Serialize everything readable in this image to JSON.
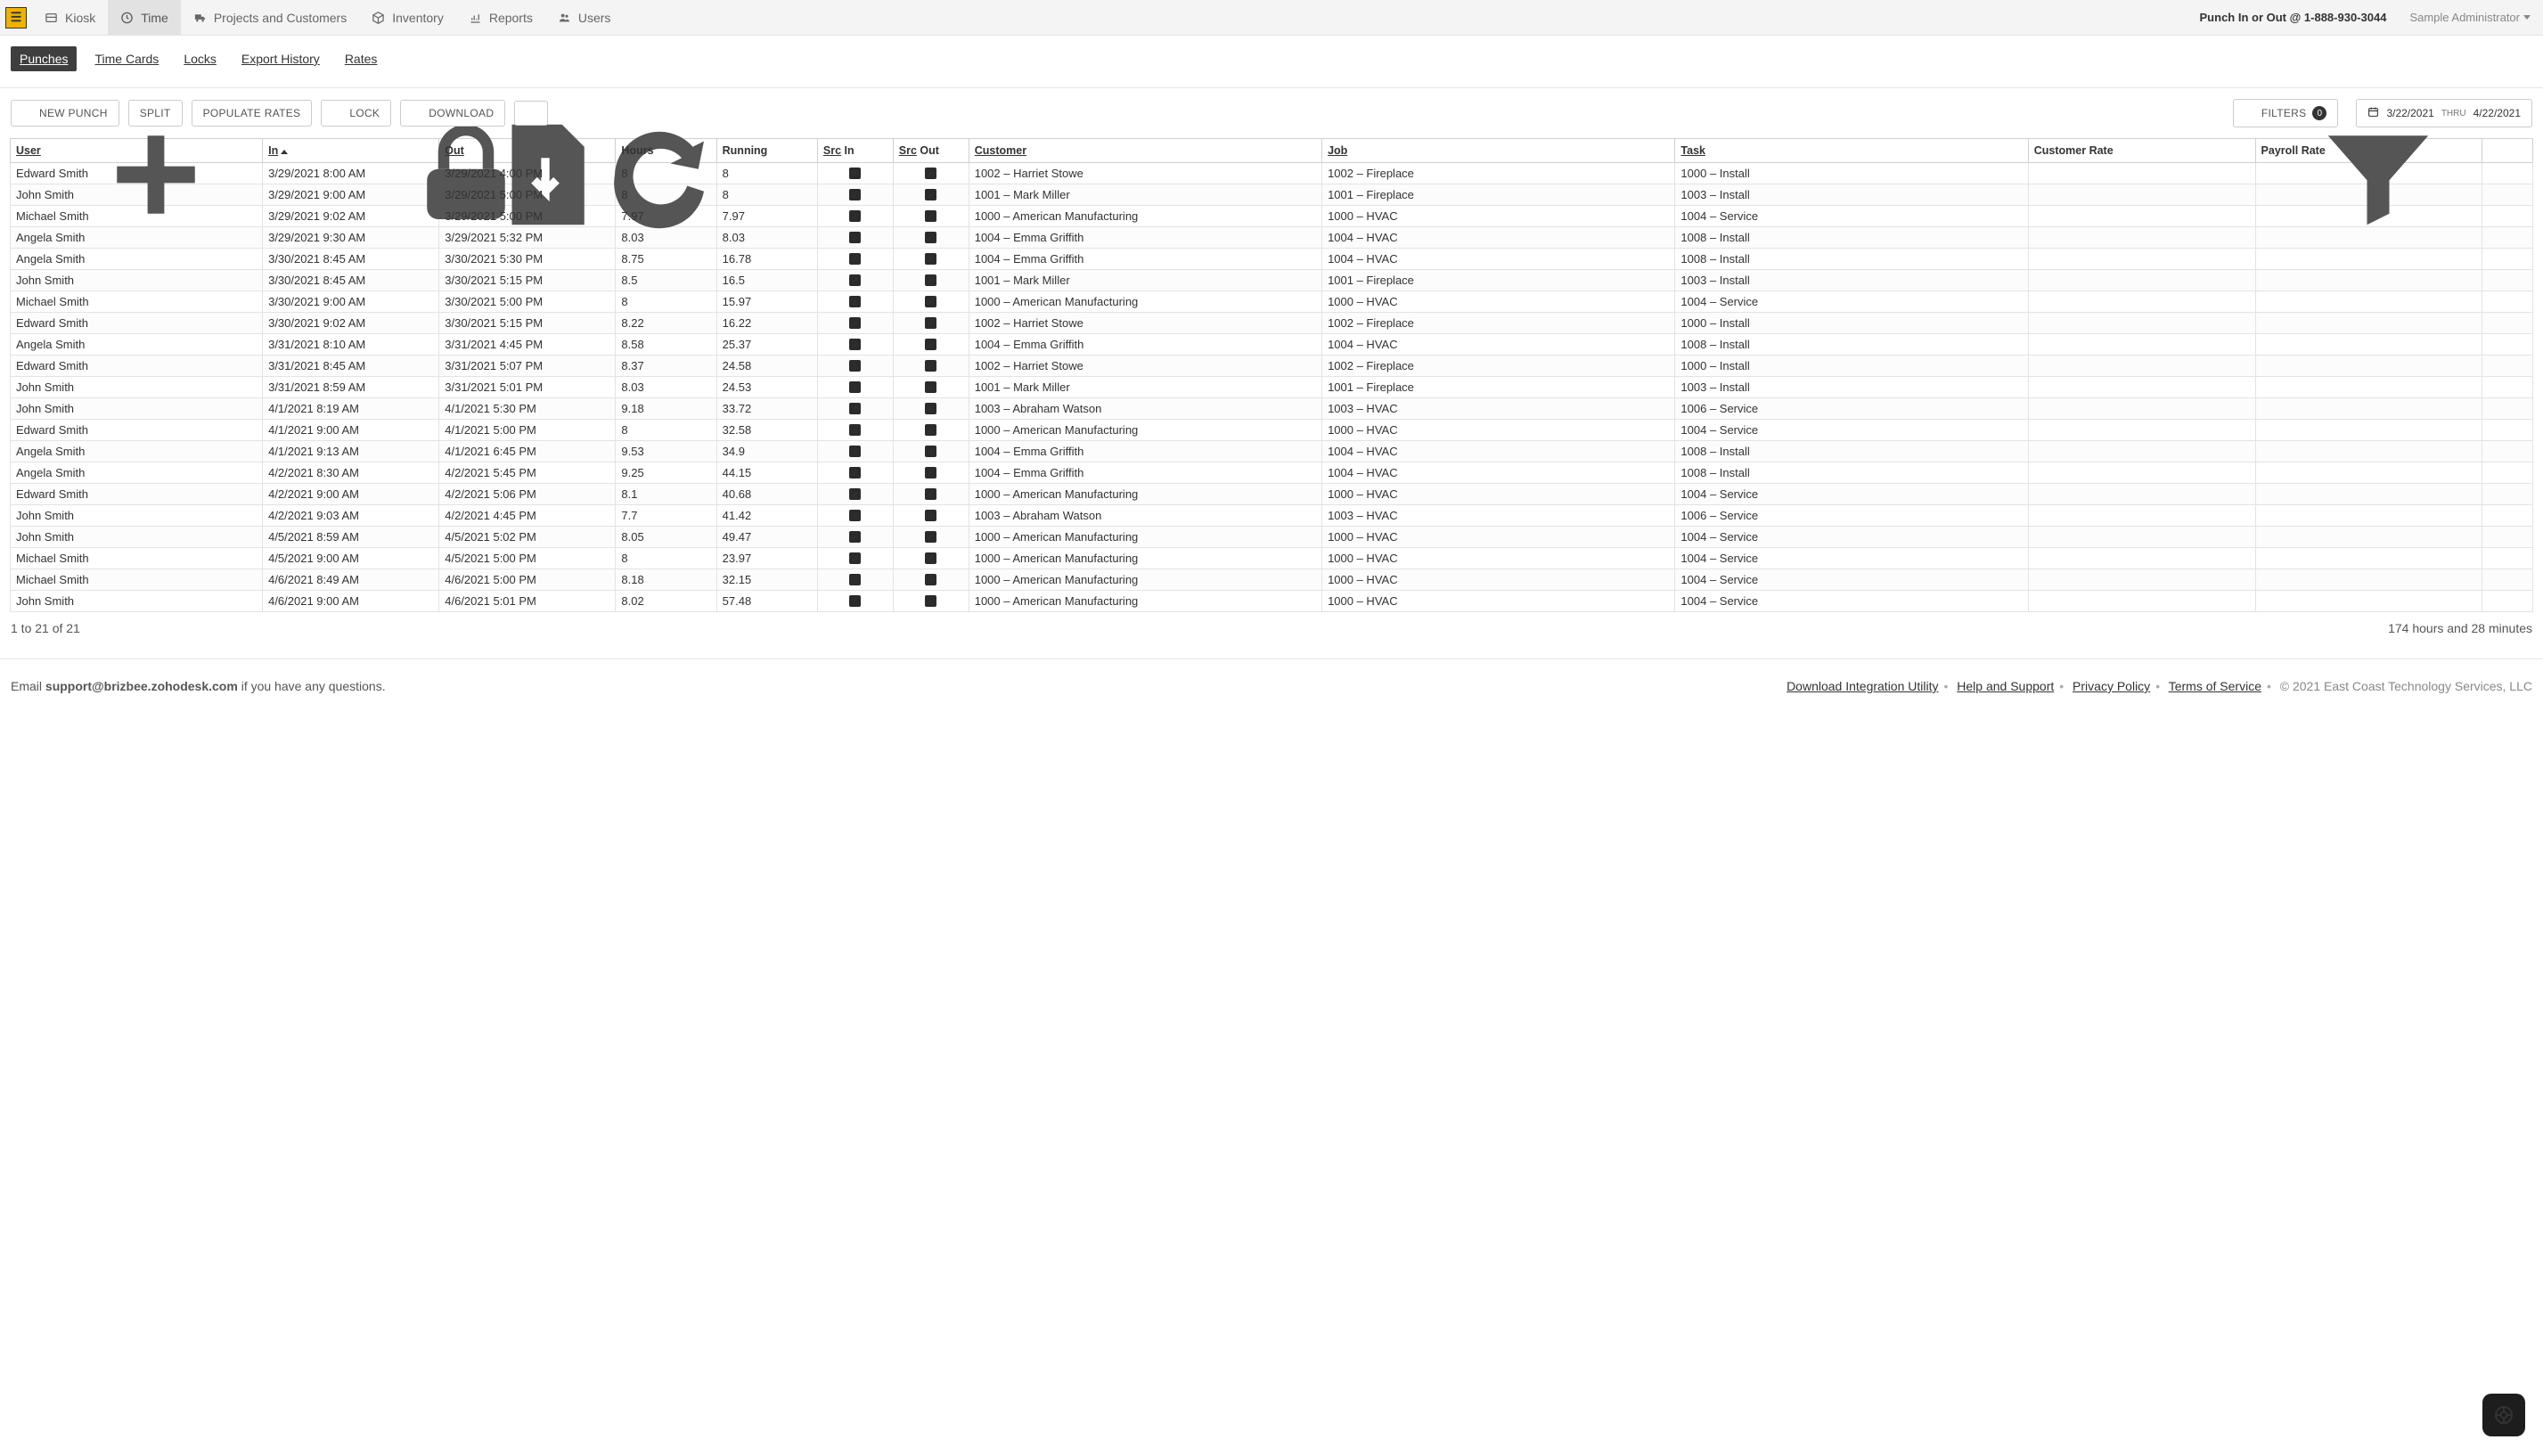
{
  "nav": {
    "items": [
      {
        "label": "Kiosk"
      },
      {
        "label": "Time"
      },
      {
        "label": "Projects and Customers"
      },
      {
        "label": "Inventory"
      },
      {
        "label": "Reports"
      },
      {
        "label": "Users"
      }
    ],
    "punch_phone": "Punch In or Out @ 1-888-930-3044",
    "current_user": "Sample Administrator"
  },
  "subnav": {
    "items": [
      "Punches",
      "Time Cards",
      "Locks",
      "Export History",
      "Rates"
    ],
    "active_index": 0
  },
  "toolbar": {
    "new_punch": "NEW PUNCH",
    "split": "SPLIT",
    "populate_rates": "POPULATE RATES",
    "lock": "LOCK",
    "download": "DOWNLOAD",
    "filters_label": "FILTERS",
    "filters_count": "0",
    "date_from": "3/22/2021",
    "date_thru_label": "THRU",
    "date_to": "4/22/2021"
  },
  "columns": {
    "user": "User",
    "in": "In",
    "out": "Out",
    "hours": "Hours",
    "running": "Running",
    "src_in_prefix": "Src",
    "src_in_suffix": " In",
    "src_out_prefix": "Src",
    "src_out_suffix": " Out",
    "customer": "Customer",
    "job": "Job",
    "task": "Task",
    "customer_rate": "Customer Rate",
    "payroll_rate": "Payroll Rate"
  },
  "rows": [
    {
      "user": "Edward Smith",
      "in": "3/29/2021 8:00 AM",
      "out": "3/29/2021 4:00 PM",
      "hours": "8",
      "running": "8",
      "customer": "1002 – Harriet Stowe",
      "job": "1002 – Fireplace",
      "task": "1000 – Install"
    },
    {
      "user": "John Smith",
      "in": "3/29/2021 9:00 AM",
      "out": "3/29/2021 5:00 PM",
      "hours": "8",
      "running": "8",
      "customer": "1001 – Mark Miller",
      "job": "1001 – Fireplace",
      "task": "1003 – Install"
    },
    {
      "user": "Michael Smith",
      "in": "3/29/2021 9:02 AM",
      "out": "3/29/2021 5:00 PM",
      "hours": "7.97",
      "running": "7.97",
      "customer": "1000 – American Manufacturing",
      "job": "1000 – HVAC",
      "task": "1004 – Service"
    },
    {
      "user": "Angela Smith",
      "in": "3/29/2021 9:30 AM",
      "out": "3/29/2021 5:32 PM",
      "hours": "8.03",
      "running": "8.03",
      "customer": "1004 – Emma Griffith",
      "job": "1004 – HVAC",
      "task": "1008 – Install"
    },
    {
      "user": "Angela Smith",
      "in": "3/30/2021 8:45 AM",
      "out": "3/30/2021 5:30 PM",
      "hours": "8.75",
      "running": "16.78",
      "customer": "1004 – Emma Griffith",
      "job": "1004 – HVAC",
      "task": "1008 – Install"
    },
    {
      "user": "John Smith",
      "in": "3/30/2021 8:45 AM",
      "out": "3/30/2021 5:15 PM",
      "hours": "8.5",
      "running": "16.5",
      "customer": "1001 – Mark Miller",
      "job": "1001 – Fireplace",
      "task": "1003 – Install"
    },
    {
      "user": "Michael Smith",
      "in": "3/30/2021 9:00 AM",
      "out": "3/30/2021 5:00 PM",
      "hours": "8",
      "running": "15.97",
      "customer": "1000 – American Manufacturing",
      "job": "1000 – HVAC",
      "task": "1004 – Service"
    },
    {
      "user": "Edward Smith",
      "in": "3/30/2021 9:02 AM",
      "out": "3/30/2021 5:15 PM",
      "hours": "8.22",
      "running": "16.22",
      "customer": "1002 – Harriet Stowe",
      "job": "1002 – Fireplace",
      "task": "1000 – Install"
    },
    {
      "user": "Angela Smith",
      "in": "3/31/2021 8:10 AM",
      "out": "3/31/2021 4:45 PM",
      "hours": "8.58",
      "running": "25.37",
      "customer": "1004 – Emma Griffith",
      "job": "1004 – HVAC",
      "task": "1008 – Install"
    },
    {
      "user": "Edward Smith",
      "in": "3/31/2021 8:45 AM",
      "out": "3/31/2021 5:07 PM",
      "hours": "8.37",
      "running": "24.58",
      "customer": "1002 – Harriet Stowe",
      "job": "1002 – Fireplace",
      "task": "1000 – Install"
    },
    {
      "user": "John Smith",
      "in": "3/31/2021 8:59 AM",
      "out": "3/31/2021 5:01 PM",
      "hours": "8.03",
      "running": "24.53",
      "customer": "1001 – Mark Miller",
      "job": "1001 – Fireplace",
      "task": "1003 – Install"
    },
    {
      "user": "John Smith",
      "in": "4/1/2021 8:19 AM",
      "out": "4/1/2021 5:30 PM",
      "hours": "9.18",
      "running": "33.72",
      "customer": "1003 – Abraham Watson",
      "job": "1003 – HVAC",
      "task": "1006 – Service"
    },
    {
      "user": "Edward Smith",
      "in": "4/1/2021 9:00 AM",
      "out": "4/1/2021 5:00 PM",
      "hours": "8",
      "running": "32.58",
      "customer": "1000 – American Manufacturing",
      "job": "1000 – HVAC",
      "task": "1004 – Service"
    },
    {
      "user": "Angela Smith",
      "in": "4/1/2021 9:13 AM",
      "out": "4/1/2021 6:45 PM",
      "hours": "9.53",
      "running": "34.9",
      "customer": "1004 – Emma Griffith",
      "job": "1004 – HVAC",
      "task": "1008 – Install"
    },
    {
      "user": "Angela Smith",
      "in": "4/2/2021 8:30 AM",
      "out": "4/2/2021 5:45 PM",
      "hours": "9.25",
      "running": "44.15",
      "customer": "1004 – Emma Griffith",
      "job": "1004 – HVAC",
      "task": "1008 – Install"
    },
    {
      "user": "Edward Smith",
      "in": "4/2/2021 9:00 AM",
      "out": "4/2/2021 5:06 PM",
      "hours": "8.1",
      "running": "40.68",
      "customer": "1000 – American Manufacturing",
      "job": "1000 – HVAC",
      "task": "1004 – Service"
    },
    {
      "user": "John Smith",
      "in": "4/2/2021 9:03 AM",
      "out": "4/2/2021 4:45 PM",
      "hours": "7.7",
      "running": "41.42",
      "customer": "1003 – Abraham Watson",
      "job": "1003 – HVAC",
      "task": "1006 – Service"
    },
    {
      "user": "John Smith",
      "in": "4/5/2021 8:59 AM",
      "out": "4/5/2021 5:02 PM",
      "hours": "8.05",
      "running": "49.47",
      "customer": "1000 – American Manufacturing",
      "job": "1000 – HVAC",
      "task": "1004 – Service"
    },
    {
      "user": "Michael Smith",
      "in": "4/5/2021 9:00 AM",
      "out": "4/5/2021 5:00 PM",
      "hours": "8",
      "running": "23.97",
      "customer": "1000 – American Manufacturing",
      "job": "1000 – HVAC",
      "task": "1004 – Service"
    },
    {
      "user": "Michael Smith",
      "in": "4/6/2021 8:49 AM",
      "out": "4/6/2021 5:00 PM",
      "hours": "8.18",
      "running": "32.15",
      "customer": "1000 – American Manufacturing",
      "job": "1000 – HVAC",
      "task": "1004 – Service"
    },
    {
      "user": "John Smith",
      "in": "4/6/2021 9:00 AM",
      "out": "4/6/2021 5:01 PM",
      "hours": "8.02",
      "running": "57.48",
      "customer": "1000 – American Manufacturing",
      "job": "1000 – HVAC",
      "task": "1004 – Service"
    }
  ],
  "grid_summary": {
    "range": "1 to 21 of 21",
    "totals": "174 hours and 28 minutes"
  },
  "footer": {
    "email_prefix": "Email ",
    "email": "support@brizbee.zohodesk.com",
    "email_suffix": " if you have any questions.",
    "links": {
      "download_util": "Download Integration Utility",
      "help_support": "Help and Support",
      "privacy": "Privacy Policy",
      "terms": "Terms of Service"
    },
    "copyright": "© 2021 East Coast Technology Services, LLC"
  }
}
